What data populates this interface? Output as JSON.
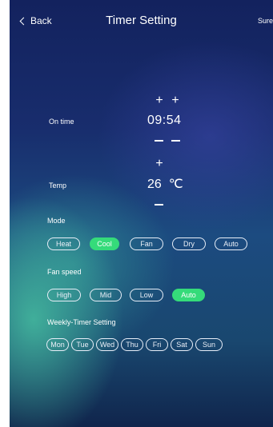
{
  "header": {
    "back_label": "Back",
    "title": "Timer Setting",
    "sure_label": "Sure"
  },
  "on_time": {
    "label": "On time",
    "hour": "09",
    "minute": "54"
  },
  "temp": {
    "label": "Temp",
    "value": "26",
    "unit": "℃"
  },
  "mode": {
    "label": "Mode",
    "options": [
      "Heat",
      "Cool",
      "Fan",
      "Dry",
      "Auto"
    ],
    "selected": "Cool"
  },
  "fan_speed": {
    "label": "Fan speed",
    "options": [
      "High",
      "Mid",
      "Low",
      "Auto"
    ],
    "selected": "Auto"
  },
  "weekly": {
    "label": "Weekly-Timer Setting",
    "days": [
      "Mon",
      "Tue",
      "Wed",
      "Thu",
      "Fri",
      "Sat",
      "Sun"
    ]
  },
  "colors": {
    "accent": "#35db7a",
    "background_top": "#13225e",
    "background_teal": "#46bea0"
  },
  "icons": {
    "back": "chevron-left-icon",
    "increment": "plus-icon",
    "decrement": "minus-icon"
  }
}
